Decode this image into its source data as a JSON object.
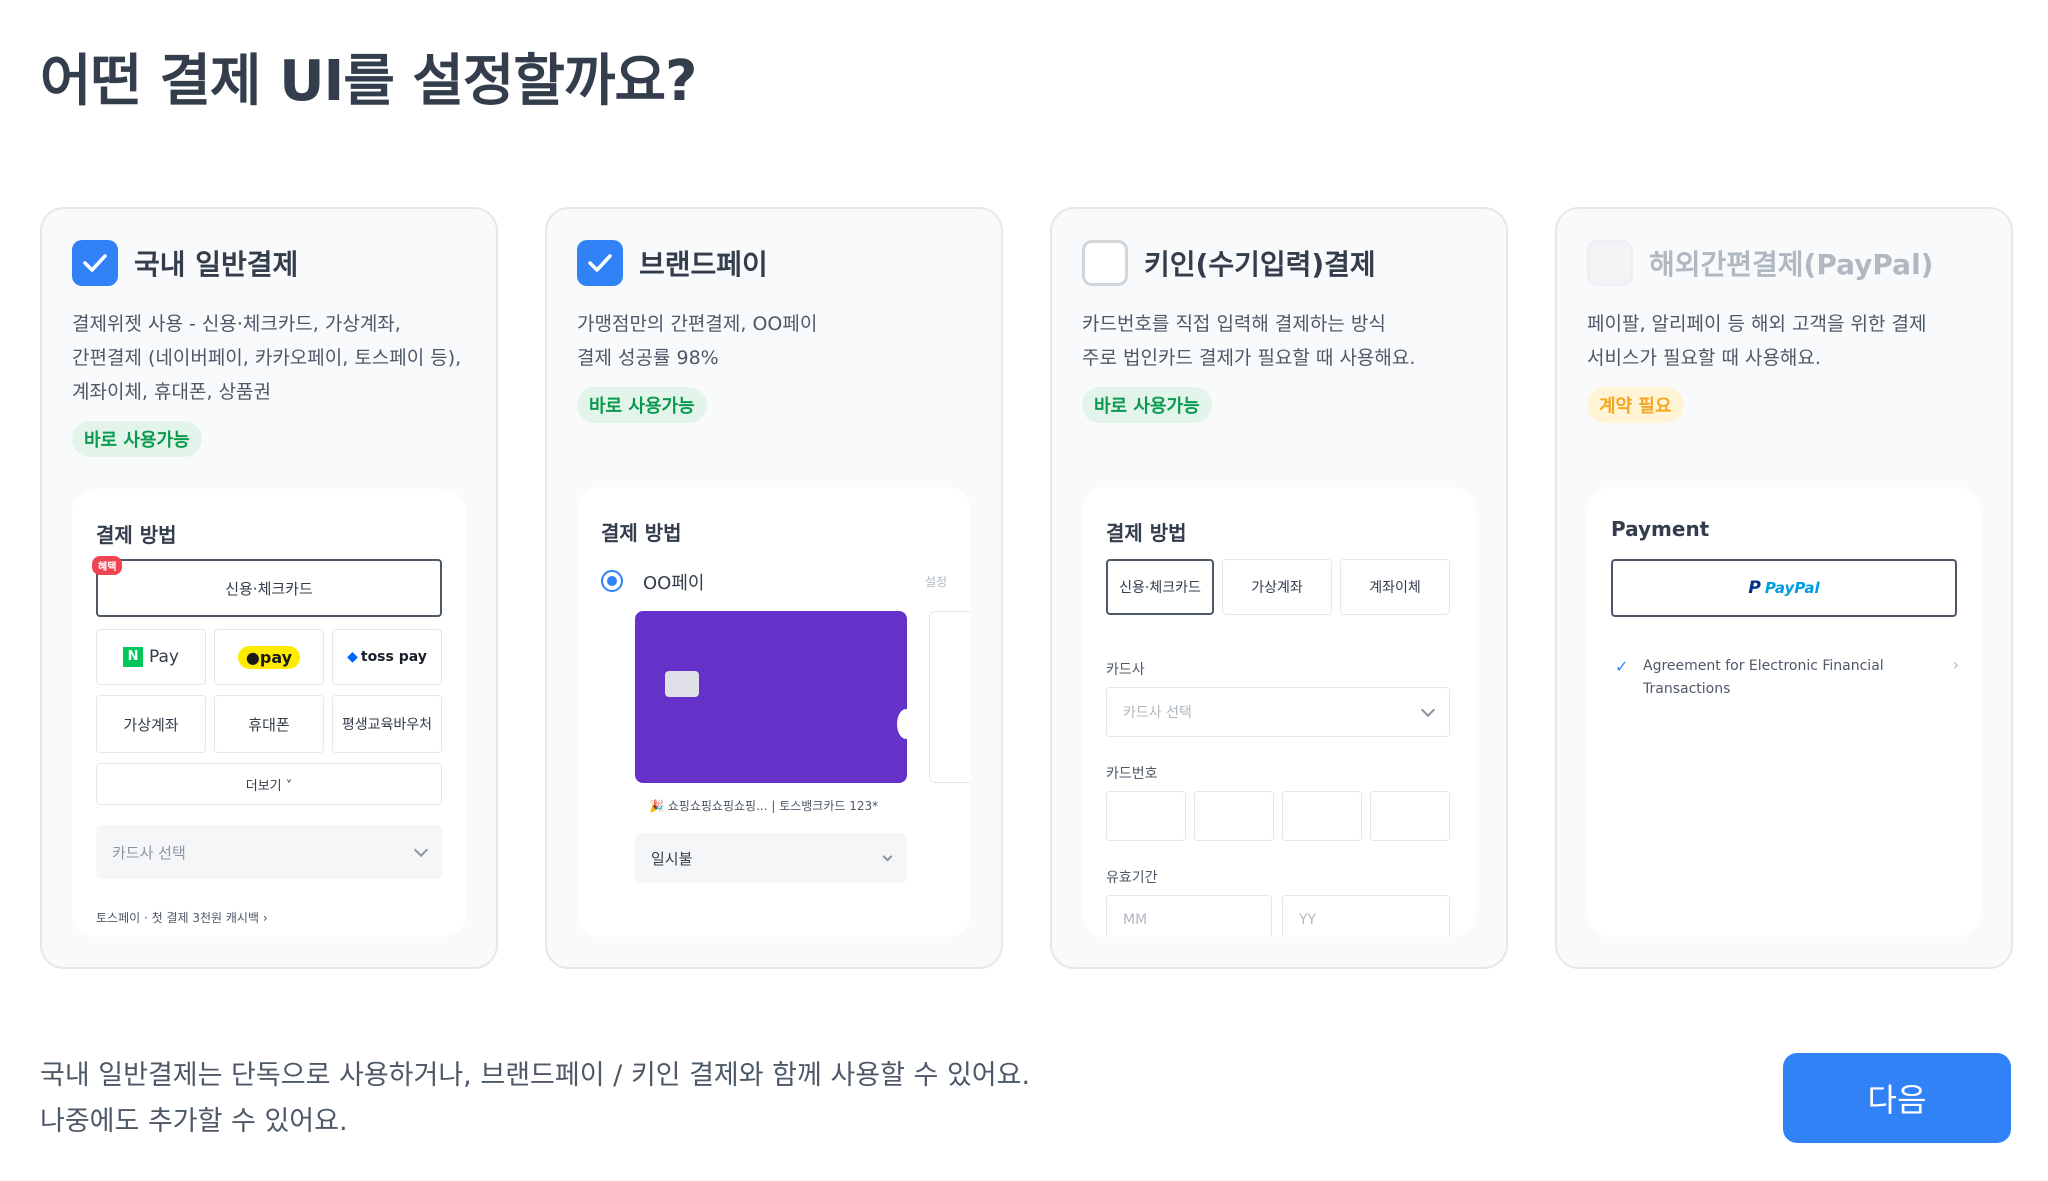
{
  "page": {
    "title": "어떤 결제 UI를 설정할까요?",
    "note_line1": "국내 일반결제는 단독으로 사용하거나, 브랜드페이 / 키인 결제와 함께 사용할 수 있어요.",
    "note_line2": "나중에도 추가할 수 있어요.",
    "next_label": "다음"
  },
  "colors": {
    "accent": "#3182f6",
    "badge_green": "#0a9a4f",
    "badge_yellow": "#f5a623",
    "card_purple": "#6432c8"
  },
  "cards": [
    {
      "title": "국내 일반결제",
      "checked": true,
      "desc_lines": [
        "결제위젯 사용 - 신용·체크카드, 가상계좌,",
        "간편결제 (네이버페이, 카카오페이, 토스페이 등),",
        "계좌이체, 휴대폰, 상품권"
      ],
      "badge": "바로 사용가능",
      "preview": {
        "title": "결제 방법",
        "highlight_tag": "혜택",
        "primary_option": "신용·체크카드",
        "easy_pay": [
          "Pay",
          "pay",
          "toss pay"
        ],
        "methods": [
          "가상계좌",
          "휴대폰",
          "평생교육바우처"
        ],
        "more": "더보기 ˅",
        "card_select": "카드사 선택",
        "promo1": "토스페이 · 첫 결제 3천원 캐시백 ›"
      }
    },
    {
      "title": "브랜드페이",
      "checked": true,
      "desc_lines": [
        "가맹점만의 간편결제, OO페이",
        "결제 성공률 98%"
      ],
      "badge": "바로 사용가능",
      "preview": {
        "title": "결제 방법",
        "method": "OO페이",
        "settings": "설정",
        "card_caption": "🎉 쇼핑쇼핑쇼핑쇼핑... | 토스뱅크카드 123*",
        "installment": "일시불"
      }
    },
    {
      "title": "키인(수기입력)결제",
      "checked": false,
      "desc_lines": [
        "카드번호를 직접 입력해 결제하는 방식",
        "주로 법인카드 결제가 필요할 때 사용해요."
      ],
      "badge": "바로 사용가능",
      "preview": {
        "title": "결제 방법",
        "tabs": [
          "신용·체크카드",
          "가상계좌",
          "계좌이체"
        ],
        "issuer_label": "카드사",
        "issuer_placeholder": "카드사 선택",
        "number_label": "카드번호",
        "expiry_label": "유효기간",
        "mm": "MM",
        "yy": "YY"
      }
    },
    {
      "title": "해외간편결제(PayPal)",
      "checked": false,
      "disabled": true,
      "desc_lines": [
        "페이팔, 알리페이 등 해외 고객을 위한 결제",
        "서비스가 필요할 때 사용해요."
      ],
      "badge": "계약 필요",
      "preview": {
        "title": "Payment",
        "paypal": "PayPal",
        "agreement_line1": "Agreement for Electronic Financial",
        "agreement_line2": "Transactions"
      }
    }
  ]
}
